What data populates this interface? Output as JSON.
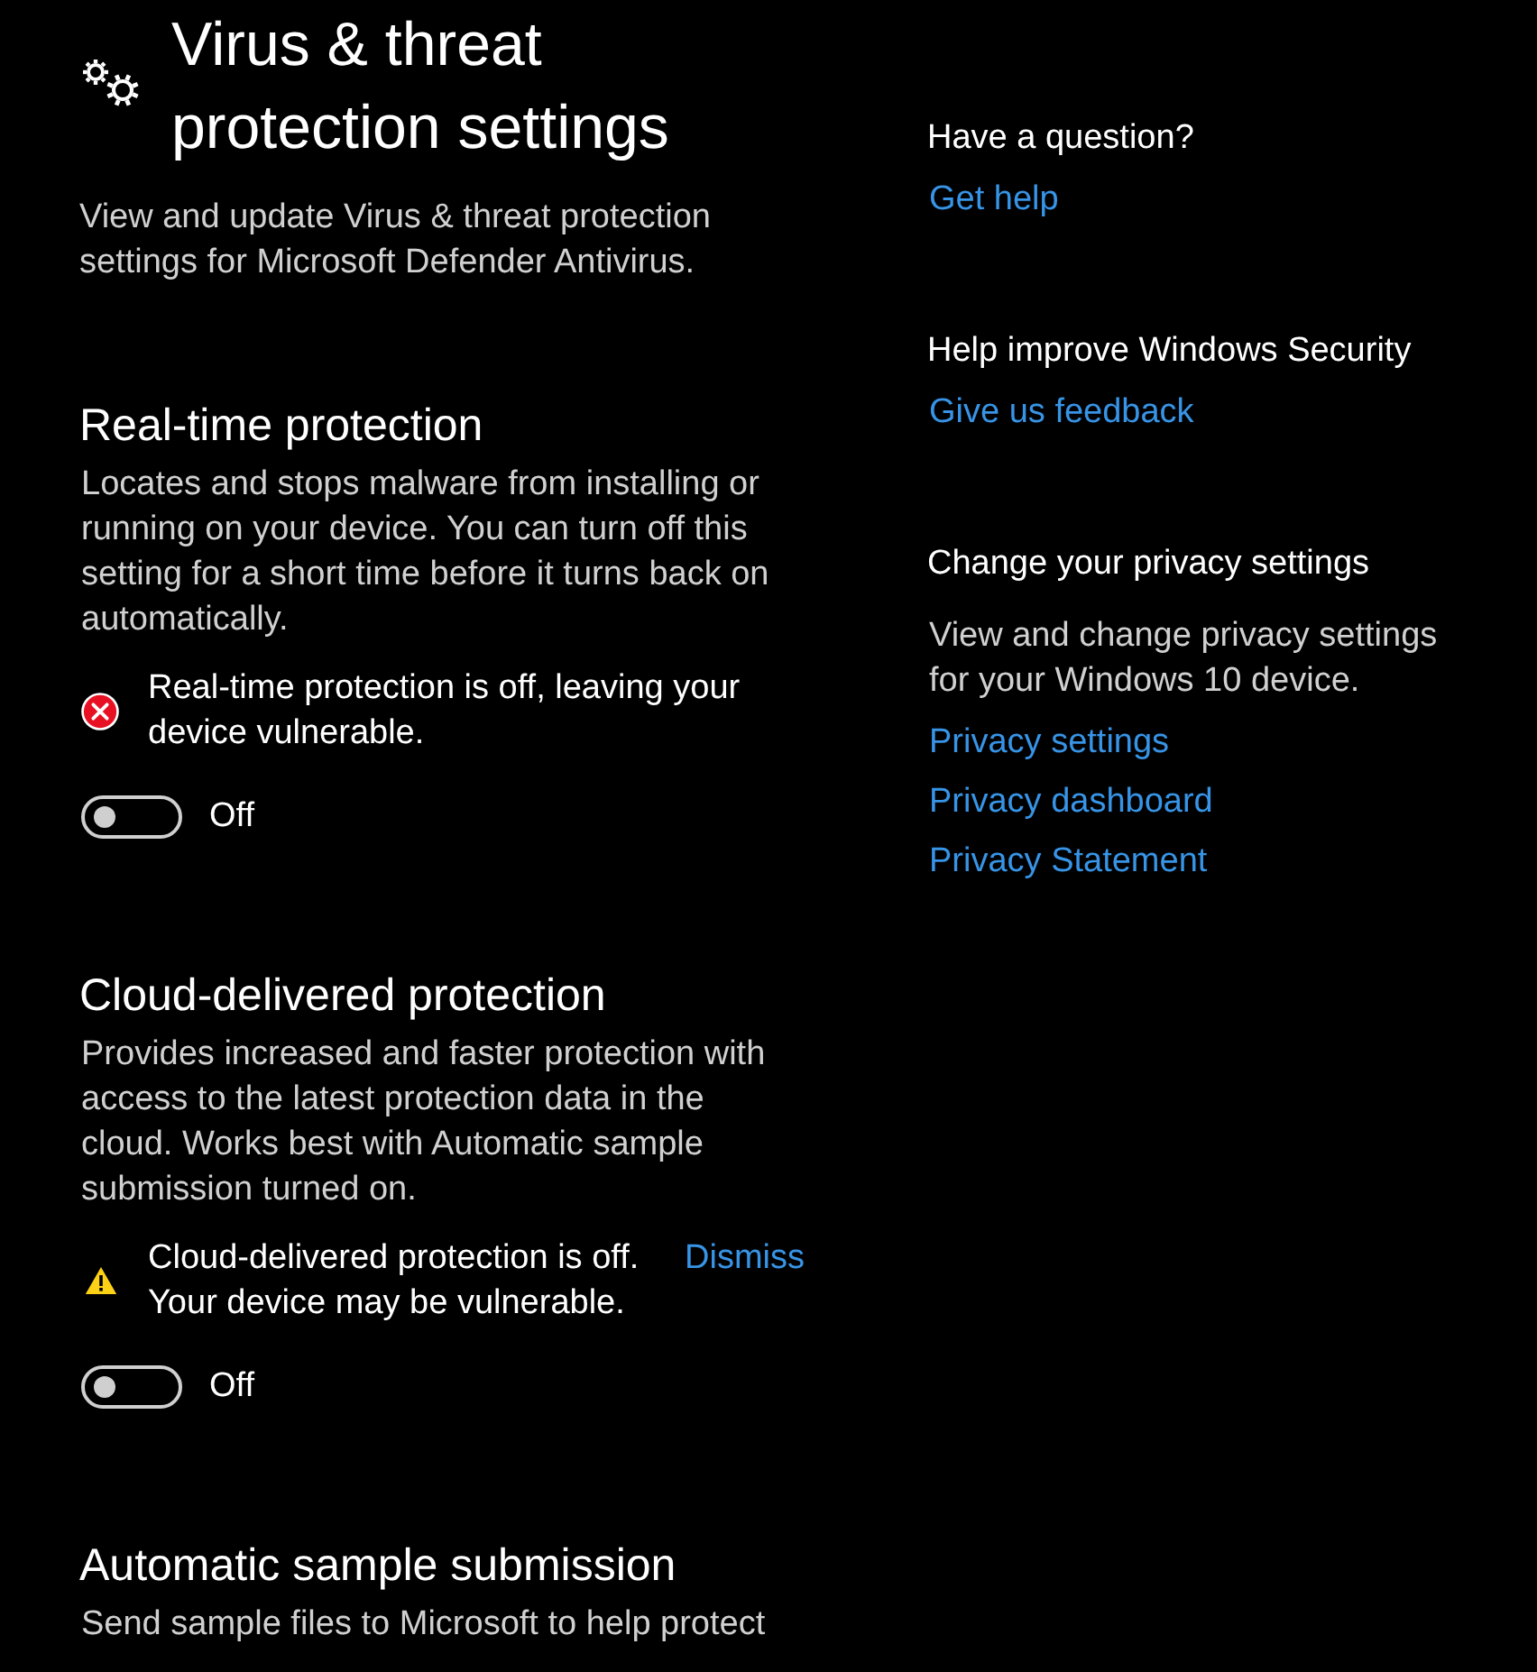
{
  "page": {
    "title": "Virus & threat protection settings",
    "description": "View and update Virus & threat protection settings for Microsoft Defender Antivirus."
  },
  "sections": [
    {
      "heading": "Real-time protection",
      "description": "Locates and stops malware from installing or running on your device. You can turn off this setting for a short time before it turns back on automatically.",
      "alert": {
        "kind": "error",
        "text": "Real-time protection is off, leaving your device vulnerable."
      },
      "toggle": {
        "on": false,
        "label": "Off"
      }
    },
    {
      "heading": "Cloud-delivered protection",
      "description": "Provides increased and faster protection with access to the latest protection data in the cloud. Works best with Automatic sample submission turned on.",
      "alert": {
        "kind": "warning",
        "text": "Cloud-delivered protection is off. Your device may be vulnerable.",
        "action": "Dismiss"
      },
      "toggle": {
        "on": false,
        "label": "Off"
      }
    },
    {
      "heading": "Automatic sample submission",
      "description": "Send sample files to Microsoft to help protect"
    }
  ],
  "sidebar": [
    {
      "heading": "Have a question?",
      "links": [
        "Get help"
      ]
    },
    {
      "heading": "Help improve Windows Security",
      "links": [
        "Give us feedback"
      ]
    },
    {
      "heading": "Change your privacy settings",
      "description": "View and change privacy settings for your Windows 10 device.",
      "links": [
        "Privacy settings",
        "Privacy dashboard",
        "Privacy Statement"
      ]
    }
  ]
}
